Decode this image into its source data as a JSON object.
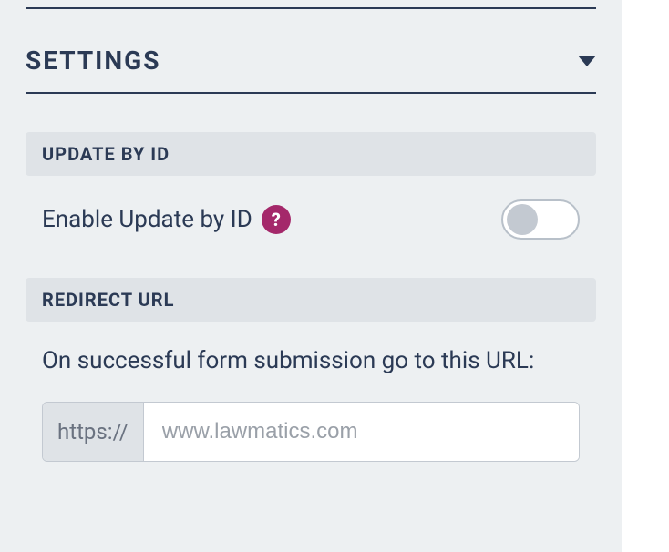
{
  "header": {
    "title": "SETTINGS"
  },
  "updateById": {
    "section_label": "UPDATE BY ID",
    "row_label": "Enable Update by ID",
    "help_glyph": "?",
    "enabled": false
  },
  "redirect": {
    "section_label": "REDIRECT URL",
    "description": "On successful form submission go to this URL:",
    "prefix": "https://",
    "placeholder": "www.lawmatics.com",
    "value": ""
  }
}
